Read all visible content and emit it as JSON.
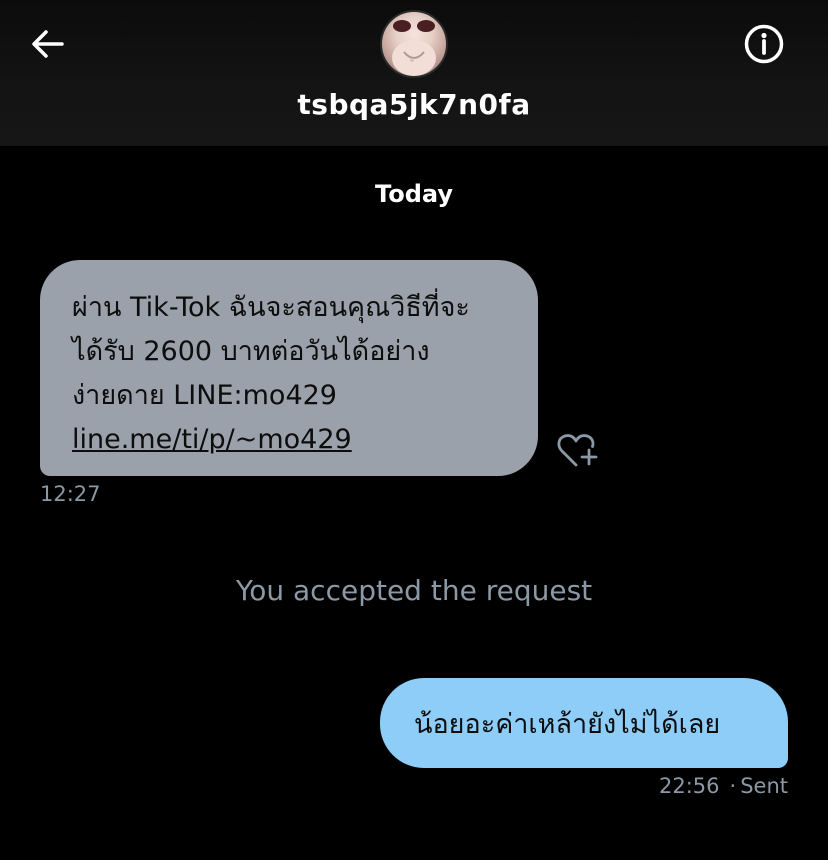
{
  "header": {
    "back_icon": "arrow-left-icon",
    "username": "tsbqa5jk7n0fa",
    "info_icon": "info-circle-icon",
    "avatar": "profile-photo"
  },
  "conversation": {
    "date_separator": "Today",
    "incoming": {
      "lines": [
        "ผ่าน Tik-Tok ฉันจะสอนคุณวิธีที่จะ",
        "ได้รับ 2600 บาทต่อวันได้อย่าง",
        "ง่ายดาย LINE:mo429"
      ],
      "link": "line.me/ti/p/~mo429",
      "time": "12:27",
      "react_icon": "heart-plus-icon"
    },
    "system_note": "You accepted the request",
    "outgoing": {
      "text": "น้อยอะค่าเหล้ายังไม่ได้เลย",
      "time": "22:56",
      "status": "Sent"
    }
  },
  "colors": {
    "background": "#000000",
    "incoming_bubble": "#9aa1aa",
    "outgoing_bubble": "#8ecdf8",
    "muted_text": "#8b98a5"
  }
}
